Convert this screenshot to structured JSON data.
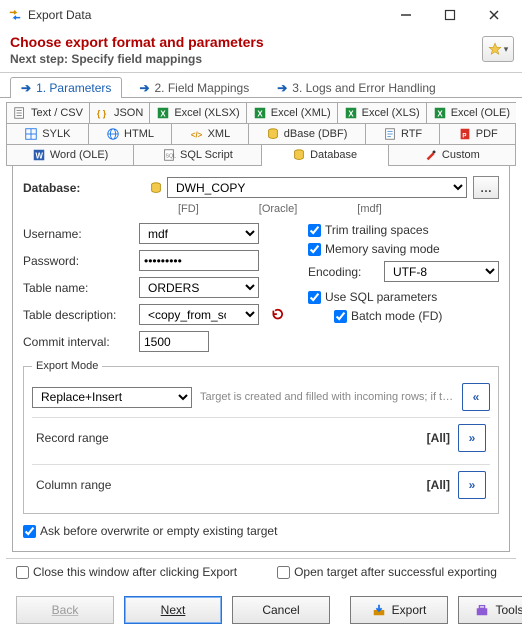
{
  "window": {
    "title": "Export Data"
  },
  "header": {
    "heading": "Choose export format and parameters",
    "subheading": "Next step: Specify field mappings"
  },
  "steps": [
    {
      "label": "1. Parameters",
      "active": true
    },
    {
      "label": "2. Field Mappings",
      "active": false
    },
    {
      "label": "3. Logs and Error Handling",
      "active": false
    }
  ],
  "formats": {
    "row1": [
      "Text / CSV",
      "JSON",
      "Excel (XLSX)",
      "Excel (XML)",
      "Excel (XLS)",
      "Excel (OLE)"
    ],
    "row2": [
      "SYLK",
      "HTML",
      "XML",
      "dBase (DBF)",
      "RTF",
      "PDF"
    ],
    "row3": [
      "Word (OLE)",
      "SQL Script",
      "Database",
      "Custom"
    ],
    "active": "Database"
  },
  "fields": {
    "database_label": "Database:",
    "database_value": "DWH_COPY",
    "db_hints": [
      "[FD]",
      "[Oracle]",
      "[mdf]"
    ],
    "username_label": "Username:",
    "username_value": "mdf",
    "password_label": "Password:",
    "password_value": "•••••••••",
    "table_label": "Table name:",
    "table_value": "ORDERS",
    "tdesc_label": "Table description:",
    "tdesc_value": "<copy_from_source>",
    "commit_label": "Commit interval:",
    "commit_value": "1500"
  },
  "options": {
    "trim": "Trim trailing spaces",
    "memory": "Memory saving mode",
    "encoding_label": "Encoding:",
    "encoding_value": "UTF-8",
    "use_sql": "Use SQL parameters",
    "batch": "Batch mode (FD)"
  },
  "export_mode": {
    "legend": "Export Mode",
    "value": "Replace+Insert",
    "hint": "Target is created and filled with incoming rows; if target..."
  },
  "ranges": {
    "record_label": "Record range",
    "record_value": "[All]",
    "column_label": "Column range",
    "column_value": "[All]"
  },
  "ask_overwrite": "Ask before overwrite or empty existing target",
  "footer": {
    "close_after": "Close this window after clicking Export",
    "open_after": "Open target after successful exporting"
  },
  "buttons": {
    "back": "Back",
    "next": "Next",
    "cancel": "Cancel",
    "export": "Export",
    "tools": "Tools"
  }
}
